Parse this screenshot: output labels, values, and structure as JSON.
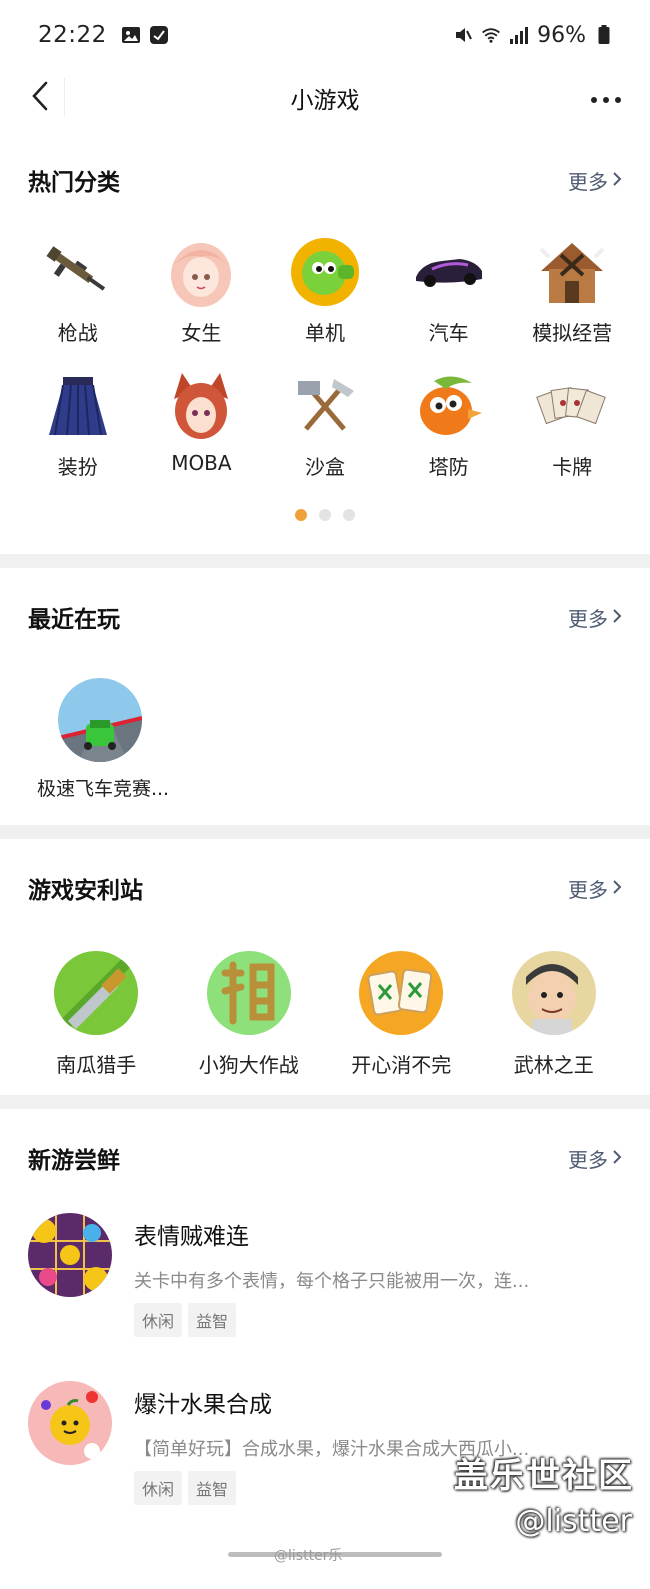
{
  "status_bar": {
    "time": "22:22",
    "battery": "96%"
  },
  "nav": {
    "title": "小游戏"
  },
  "hot_categories": {
    "title": "热门分类",
    "more": "更多",
    "items": [
      {
        "label": "枪战",
        "icon": "rifle-icon"
      },
      {
        "label": "女生",
        "icon": "anime-girl-icon"
      },
      {
        "label": "单机",
        "icon": "peashooter-icon"
      },
      {
        "label": "汽车",
        "icon": "race-car-icon"
      },
      {
        "label": "模拟经营",
        "icon": "hut-icon"
      },
      {
        "label": "装扮",
        "icon": "skirt-icon"
      },
      {
        "label": "MOBA",
        "icon": "fox-heroine-icon"
      },
      {
        "label": "沙盒",
        "icon": "hammer-pickaxe-icon"
      },
      {
        "label": "塔防",
        "icon": "bird-icon"
      },
      {
        "label": "卡牌",
        "icon": "cards-icon"
      }
    ],
    "pages": 3,
    "active_page": 1
  },
  "recent": {
    "title": "最近在玩",
    "more": "更多",
    "items": [
      {
        "label": "极速飞车竞赛...",
        "icon": "green-car-track-icon"
      }
    ]
  },
  "promo": {
    "title": "游戏安利站",
    "more": "更多",
    "items": [
      {
        "label": "南瓜猎手",
        "icon": "sword-icon"
      },
      {
        "label": "小狗大作战",
        "icon": "dog-glyph-icon"
      },
      {
        "label": "开心消不完",
        "icon": "mahjong-tile-icon"
      },
      {
        "label": "武林之王",
        "icon": "warrior-icon"
      }
    ]
  },
  "new_games": {
    "title": "新游尝鲜",
    "more": "更多",
    "items": [
      {
        "title": "表情贼难连",
        "desc": "关卡中有多个表情，每个格子只能被用一次，连...",
        "tags": [
          "休闲",
          "益智"
        ],
        "icon": "emoji-grid-icon"
      },
      {
        "title": "爆汁水果合成",
        "desc": "【简单好玩】合成水果，爆汁水果合成大西瓜小...",
        "tags": [
          "休闲",
          "益智"
        ],
        "icon": "fruit-icon"
      }
    ]
  },
  "watermark": {
    "brand": "盖乐世社区",
    "handle": "@listter",
    "small": "@listter乐"
  },
  "colors": {
    "accent_dot": "#f0a23a",
    "more_link": "#4e5b70",
    "divider_band": "#f0f0f0"
  }
}
